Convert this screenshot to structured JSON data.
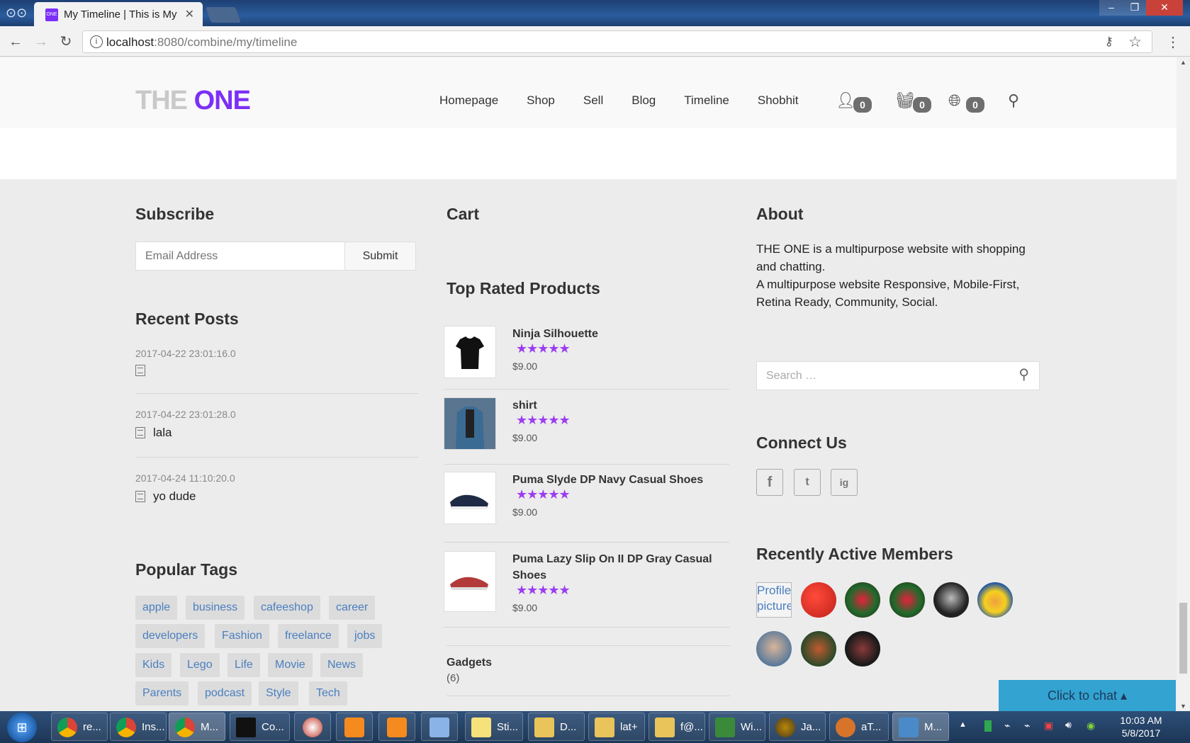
{
  "browser": {
    "tab_title": "My Timeline | This is My",
    "close_glyph": "✕",
    "url_host": "localhost",
    "url_rest": ":8080/combine/my/timeline",
    "window_controls": [
      "–",
      "❐",
      "✕"
    ]
  },
  "site": {
    "logo_light": "THE",
    "logo_accent": "ONE",
    "accent_color": "#7b2ff7",
    "nav": [
      "Homepage",
      "Shop",
      "Sell",
      "Blog",
      "Timeline",
      "Shobhit"
    ],
    "badges": {
      "user": "0",
      "cart": "0",
      "globe": "0"
    }
  },
  "subscribe": {
    "title": "Subscribe",
    "email_placeholder": "Email Address",
    "submit_label": "Submit"
  },
  "recent_posts": {
    "title": "Recent Posts",
    "posts": [
      {
        "date": "2017-04-22 23:01:16.0",
        "title": ""
      },
      {
        "date": "2017-04-22 23:01:28.0",
        "title": "lala"
      },
      {
        "date": "2017-04-24 11:10:20.0",
        "title": "yo dude"
      }
    ]
  },
  "popular_tags": {
    "title": "Popular Tags",
    "tags": [
      "apple",
      "business",
      "cafeeshop",
      "career",
      "developers",
      "Fashion",
      "freelance",
      "jobs",
      "Kids",
      "Lego",
      "Life",
      "Movie",
      "News",
      "Parents",
      "podcast",
      "Style",
      "Tech"
    ]
  },
  "cart": {
    "title": "Cart"
  },
  "top_rated": {
    "title": "Top Rated Products",
    "stars": "★★★★★",
    "products": [
      {
        "name": "Ninja Silhouette",
        "price": "$9.00",
        "rating": 5
      },
      {
        "name": "shirt",
        "price": "$9.00",
        "rating": 5
      },
      {
        "name": "Puma Slyde DP Navy Casual Shoes",
        "price": "$9.00",
        "rating": 5
      },
      {
        "name": "Puma Lazy Slip On II DP Gray Casual Shoes",
        "price": "$9.00",
        "rating": 5
      }
    ]
  },
  "categories": [
    {
      "name": "Gadgets",
      "count": "(6)"
    }
  ],
  "about": {
    "title": "About",
    "line1": "THE ONE is a multipurpose website with shopping and chatting.",
    "line2": "A multipurpose website Responsive, Mobile-First, Retina Ready, Community, Social."
  },
  "search": {
    "placeholder": "Search …"
  },
  "connect": {
    "title": "Connect Us",
    "networks": [
      "f",
      "t",
      "ig"
    ]
  },
  "members": {
    "title": "Recently Active Members",
    "broken_alt": "Profile picture"
  },
  "chat": {
    "label": "Click to chat ▴"
  },
  "taskbar": {
    "items": [
      "re...",
      "Ins...",
      "M...",
      "Co...",
      "",
      "",
      "",
      "",
      "Sti...",
      "D...",
      "lat+",
      "f@...",
      "Wi...",
      "Ja...",
      "aT...",
      "M..."
    ],
    "time": "10:03 AM",
    "date": "5/8/2017"
  }
}
